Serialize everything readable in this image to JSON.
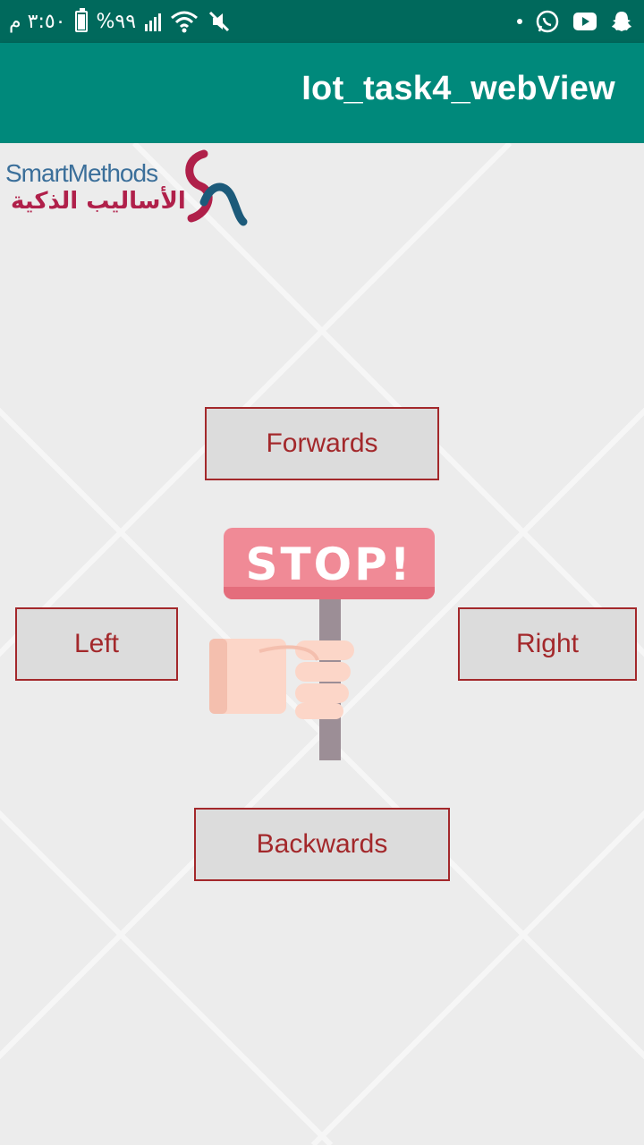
{
  "status_bar": {
    "time": "٣:٥٠ م",
    "battery": "%٩٩",
    "icons": [
      "battery-icon",
      "signal-icon",
      "wifi-icon",
      "mute-icon",
      "dot-icon",
      "whatsapp-icon",
      "youtube-icon",
      "snapchat-icon"
    ]
  },
  "toolbar": {
    "title": "Iot_task4_webView"
  },
  "logo": {
    "english": "SmartMethods",
    "arabic": "الأساليب الذكية"
  },
  "controls": {
    "forwards": "Forwards",
    "left": "Left",
    "right": "Right",
    "backwards": "Backwards",
    "stop": "STOP!"
  },
  "colors": {
    "status_bar": "#00695c",
    "toolbar": "#00897b",
    "button_border": "#a3282b",
    "button_bg": "#dcdcdc",
    "stop_board": "#f08a96"
  }
}
